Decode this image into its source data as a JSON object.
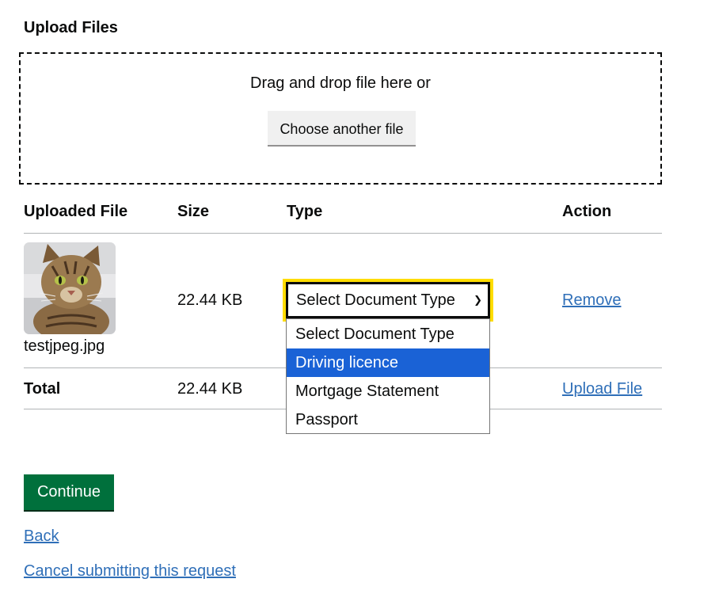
{
  "page": {
    "heading": "Upload Files"
  },
  "dropzone": {
    "instruction": "Drag and drop file here or",
    "choose_button": "Choose another file"
  },
  "table": {
    "headers": [
      "Uploaded File",
      "Size",
      "Type",
      "Action"
    ],
    "rows": [
      {
        "thumbnail": "cat-photo-thumbnail",
        "file_name": "testjpeg.jpg",
        "size": "22.44 KB",
        "type_select": {
          "value": "Select Document Type",
          "chevron_icon": "chevron-down-icon",
          "expanded": true,
          "options": [
            "Select Document Type",
            "Driving licence",
            "Mortgage Statement",
            "Passport"
          ],
          "highlighted": "Driving licence"
        },
        "action": "Remove"
      }
    ],
    "total": {
      "label": "Total",
      "size": "22.44 KB",
      "action": "Upload File"
    }
  },
  "actions": {
    "continue": "Continue",
    "back": "Back",
    "cancel": "Cancel submitting this request"
  },
  "colors": {
    "continue_button": "#00703c",
    "focus_ring": "#ffdd00",
    "link": "#2f6fb8",
    "option_highlight": "#1a62d6"
  }
}
